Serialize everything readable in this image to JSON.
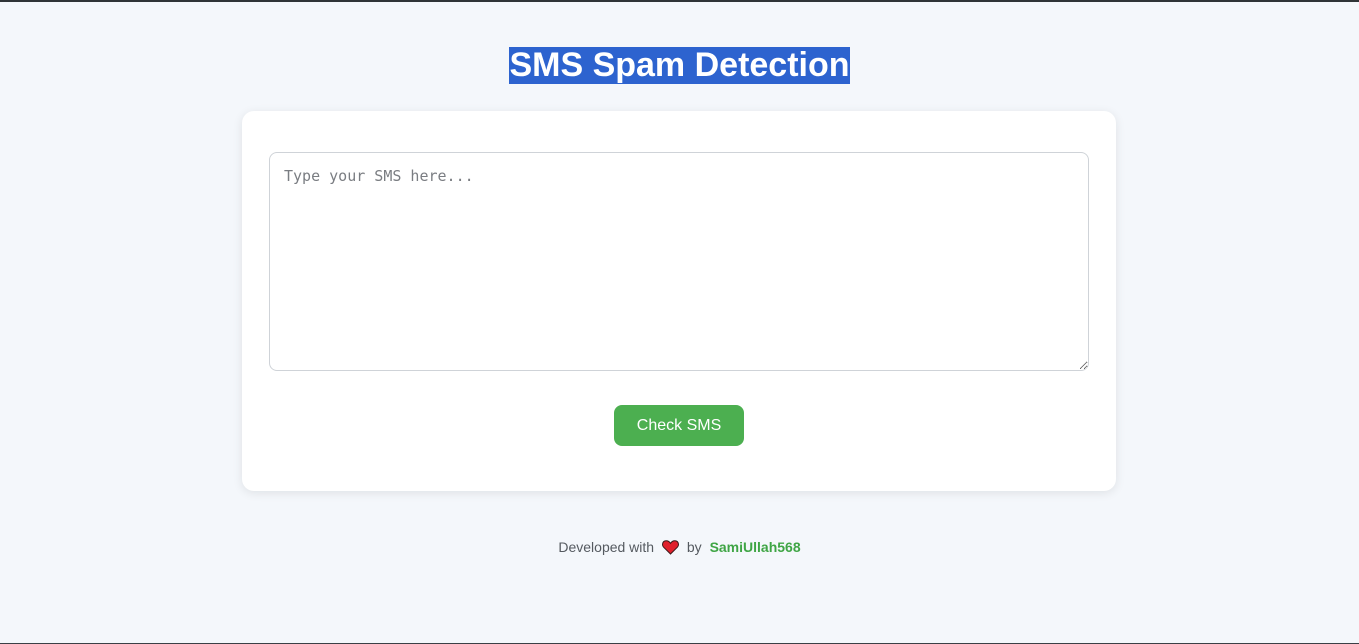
{
  "header": {
    "title": "SMS Spam Detection"
  },
  "form": {
    "sms_placeholder": "Type your SMS here...",
    "sms_value": "",
    "submit_label": "Check SMS"
  },
  "footer": {
    "prefix": "Developed with",
    "heart_icon": "heart-icon",
    "middle": "by",
    "author": "SamiUllah568"
  },
  "colors": {
    "background": "#f4f7fb",
    "title_highlight": "#2d63cf",
    "button": "#4caf50",
    "author_link": "#3fa545",
    "heart": "#e0202c"
  }
}
